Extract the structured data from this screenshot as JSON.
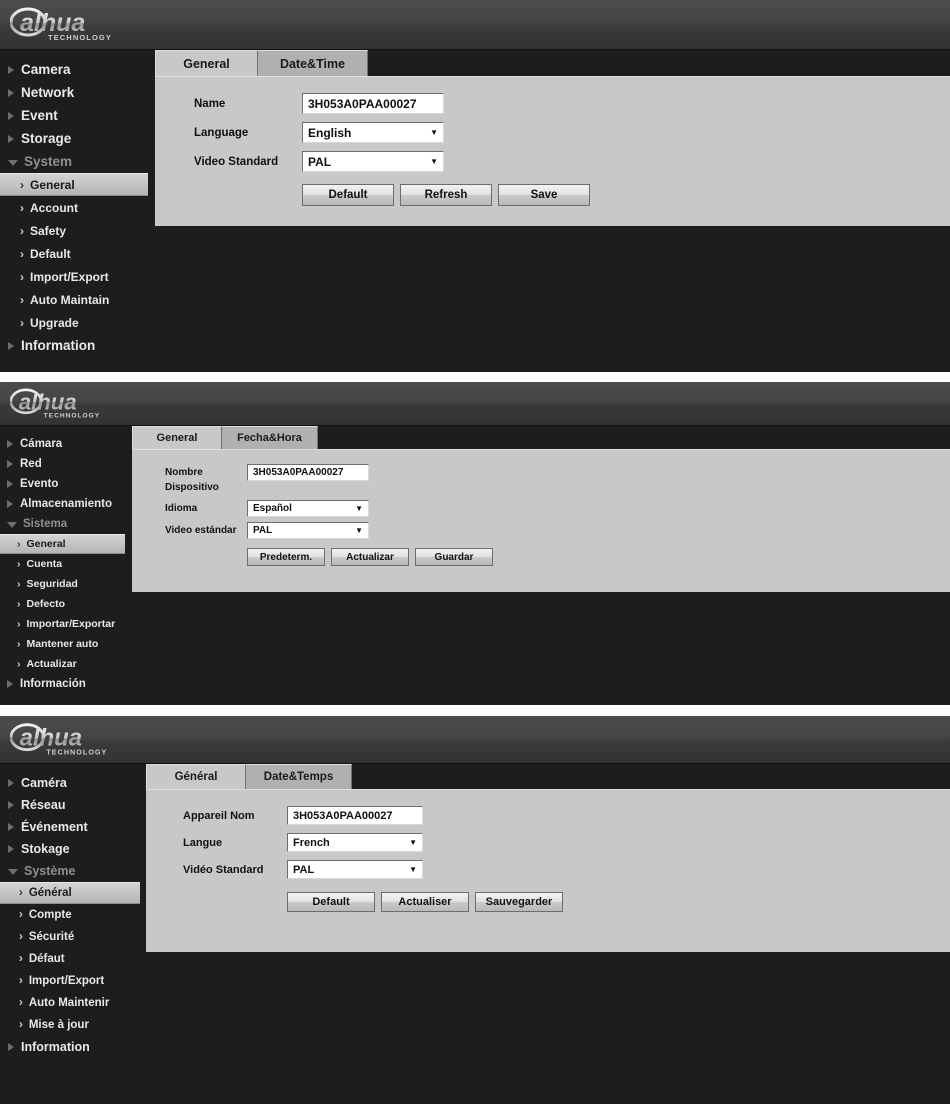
{
  "brand": {
    "name": "alhua",
    "tagline": "TECHNOLOGY"
  },
  "panels": [
    {
      "id": "english",
      "sidebar": [
        {
          "label": "Camera",
          "level": "top",
          "state": "collapsed"
        },
        {
          "label": "Network",
          "level": "top",
          "state": "collapsed"
        },
        {
          "label": "Event",
          "level": "top",
          "state": "collapsed"
        },
        {
          "label": "Storage",
          "level": "top",
          "state": "collapsed"
        },
        {
          "label": "System",
          "level": "top",
          "state": "expanded"
        },
        {
          "label": "General",
          "level": "sub",
          "state": "active"
        },
        {
          "label": "Account",
          "level": "sub",
          "state": "normal"
        },
        {
          "label": "Safety",
          "level": "sub",
          "state": "normal"
        },
        {
          "label": "Default",
          "level": "sub",
          "state": "normal"
        },
        {
          "label": "Import/Export",
          "level": "sub",
          "state": "normal"
        },
        {
          "label": "Auto Maintain",
          "level": "sub",
          "state": "normal"
        },
        {
          "label": "Upgrade",
          "level": "sub",
          "state": "normal"
        },
        {
          "label": "Information",
          "level": "top",
          "state": "collapsed"
        }
      ],
      "tabs": [
        {
          "label": "General",
          "selected": true
        },
        {
          "label": "Date&Time",
          "selected": false
        }
      ],
      "fields": {
        "name_label": "Name",
        "name_value": "3H053A0PAA00027",
        "language_label": "Language",
        "language_value": "English",
        "video_label": "Video Standard",
        "video_value": "PAL"
      },
      "buttons": [
        "Default",
        "Refresh",
        "Save"
      ]
    },
    {
      "id": "spanish",
      "sidebar": [
        {
          "label": "Cámara",
          "level": "top",
          "state": "collapsed"
        },
        {
          "label": "Red",
          "level": "top",
          "state": "collapsed"
        },
        {
          "label": "Evento",
          "level": "top",
          "state": "collapsed"
        },
        {
          "label": "Almacenamiento",
          "level": "top",
          "state": "collapsed"
        },
        {
          "label": "Sistema",
          "level": "top",
          "state": "expanded"
        },
        {
          "label": "General",
          "level": "sub",
          "state": "active"
        },
        {
          "label": "Cuenta",
          "level": "sub",
          "state": "normal"
        },
        {
          "label": "Seguridad",
          "level": "sub",
          "state": "normal"
        },
        {
          "label": "Defecto",
          "level": "sub",
          "state": "normal"
        },
        {
          "label": "Importar/Exportar",
          "level": "sub",
          "state": "normal"
        },
        {
          "label": "Mantener auto",
          "level": "sub",
          "state": "normal"
        },
        {
          "label": "Actualizar",
          "level": "sub",
          "state": "normal"
        },
        {
          "label": "Información",
          "level": "top",
          "state": "collapsed"
        }
      ],
      "tabs": [
        {
          "label": "General",
          "selected": true
        },
        {
          "label": "Fecha&Hora",
          "selected": false
        }
      ],
      "fields": {
        "name_label": "Nombre Dispositivo",
        "name_value": "3H053A0PAA00027",
        "language_label": "Idioma",
        "language_value": "Español",
        "video_label": "Video estándar",
        "video_value": "PAL"
      },
      "buttons": [
        "Predeterm.",
        "Actualizar",
        "Guardar"
      ]
    },
    {
      "id": "french",
      "sidebar": [
        {
          "label": "Caméra",
          "level": "top",
          "state": "collapsed"
        },
        {
          "label": "Réseau",
          "level": "top",
          "state": "collapsed"
        },
        {
          "label": "Événement",
          "level": "top",
          "state": "collapsed"
        },
        {
          "label": "Stokage",
          "level": "top",
          "state": "collapsed"
        },
        {
          "label": "Système",
          "level": "top",
          "state": "expanded"
        },
        {
          "label": "Général",
          "level": "sub",
          "state": "active"
        },
        {
          "label": "Compte",
          "level": "sub",
          "state": "normal"
        },
        {
          "label": "Sécurité",
          "level": "sub",
          "state": "normal"
        },
        {
          "label": "Défaut",
          "level": "sub",
          "state": "normal"
        },
        {
          "label": "Import/Export",
          "level": "sub",
          "state": "normal"
        },
        {
          "label": "Auto Maintenir",
          "level": "sub",
          "state": "normal"
        },
        {
          "label": "Mise à jour",
          "level": "sub",
          "state": "normal"
        },
        {
          "label": "Information",
          "level": "top",
          "state": "collapsed"
        }
      ],
      "tabs": [
        {
          "label": "Général",
          "selected": true
        },
        {
          "label": "Date&Temps",
          "selected": false
        }
      ],
      "fields": {
        "name_label": "Appareil Nom",
        "name_value": "3H053A0PAA00027",
        "language_label": "Langue",
        "language_value": "French",
        "video_label": "Vidéo Standard",
        "video_value": "PAL"
      },
      "buttons": [
        "Default",
        "Actualiser",
        "Sauvegarder"
      ]
    }
  ],
  "colors": {
    "sidebar_bg": "#1d1d1d",
    "header_bg": "#3f3f3f",
    "panel_bg": "#c8c8c8",
    "tab_unselected": "#b0b0b0",
    "active_item": "#c4c4c4",
    "text_light": "#e8e8e8"
  },
  "icons": {
    "collapsed": "triangle-right-icon",
    "expanded": "triangle-down-icon",
    "sub": "chevron-right-icon",
    "dropdown": "caret-down-icon"
  }
}
